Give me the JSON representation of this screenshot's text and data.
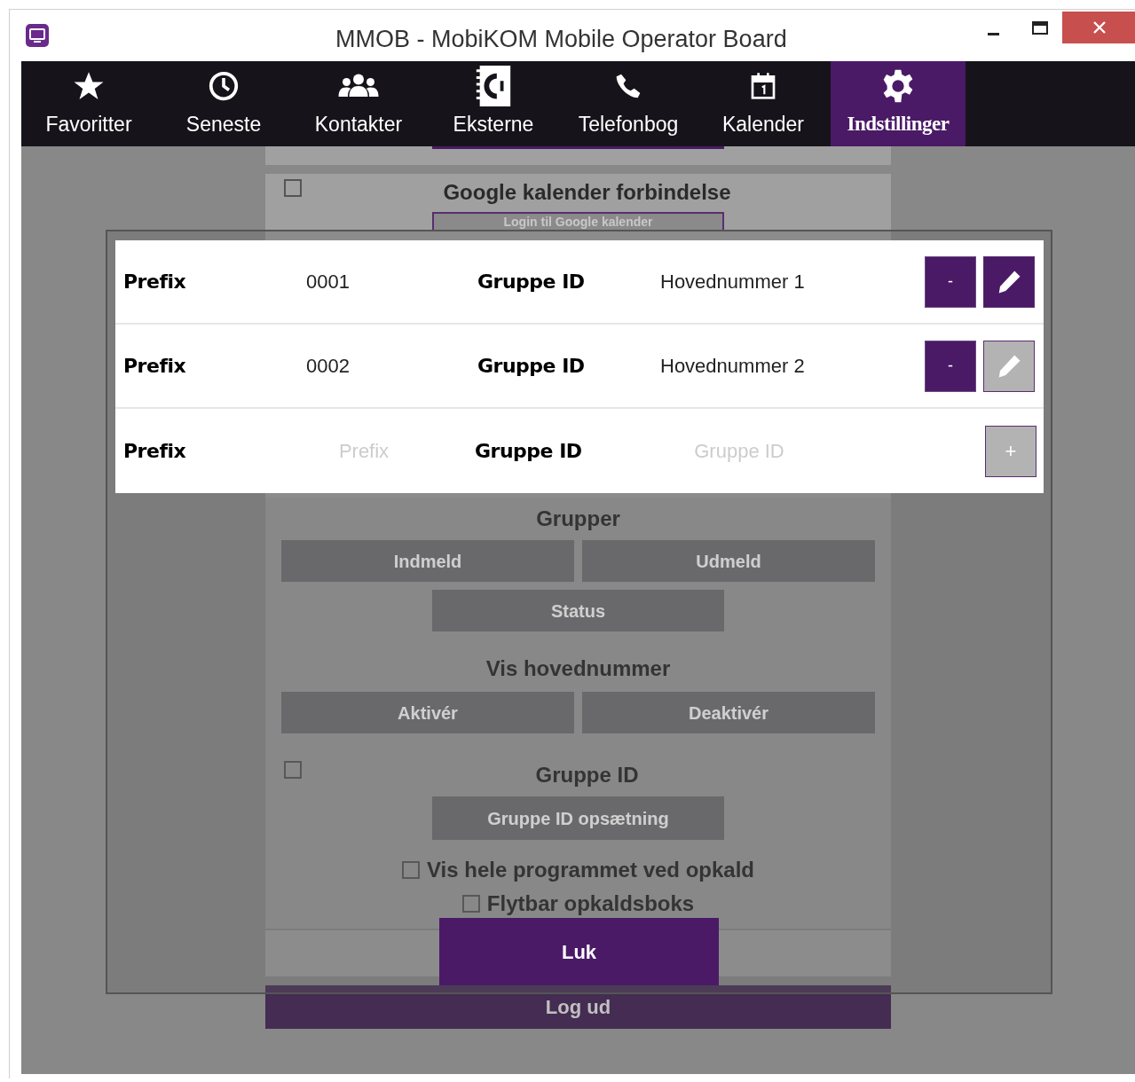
{
  "window": {
    "title": "MMOB - MobiKOM Mobile Operator Board"
  },
  "tabs": [
    {
      "label": "Favoritter",
      "selected": false
    },
    {
      "label": "Seneste",
      "selected": false
    },
    {
      "label": "Kontakter",
      "selected": false
    },
    {
      "label": "Eksterne",
      "selected": false
    },
    {
      "label": "Telefonbog",
      "selected": false
    },
    {
      "label": "Kalender",
      "selected": false
    },
    {
      "label": "Indstillinger",
      "selected": true
    }
  ],
  "settings": {
    "google_calendar": {
      "label": "Google kalender forbindelse",
      "checked": false,
      "button": "Login til Google kalender"
    },
    "groups": {
      "title": "Grupper",
      "buttons": [
        "Indmeld",
        "Udmeld"
      ],
      "status_button": "Status"
    },
    "main_number": {
      "title": "Vis hovednummer",
      "buttons": [
        "Aktivér",
        "Deaktivér"
      ]
    },
    "group_id": {
      "label": "Gruppe ID",
      "checked": false,
      "button": "Gruppe ID opsætning"
    },
    "options": [
      {
        "label": "Vis hele programmet ved opkald",
        "checked": false
      },
      {
        "label": "Flytbar opkaldsboks",
        "checked": false
      }
    ],
    "logout": "Log ud"
  },
  "dialog": {
    "rows": [
      {
        "prefix_label": "Prefix",
        "prefix": "0001",
        "group_label": "Gruppe ID",
        "group_id": "Hovednummer 1",
        "remove": "-",
        "edit_disabled": false
      },
      {
        "prefix_label": "Prefix",
        "prefix": "0002",
        "group_label": "Gruppe ID",
        "group_id": "Hovednummer 2",
        "remove": "-",
        "edit_disabled": true
      }
    ],
    "new_row": {
      "prefix_label": "Prefix",
      "prefix_placeholder": "Prefix",
      "group_label": "Gruppe ID",
      "group_placeholder": "Gruppe ID",
      "add": "+",
      "add_disabled": true
    },
    "close": "Luk"
  }
}
